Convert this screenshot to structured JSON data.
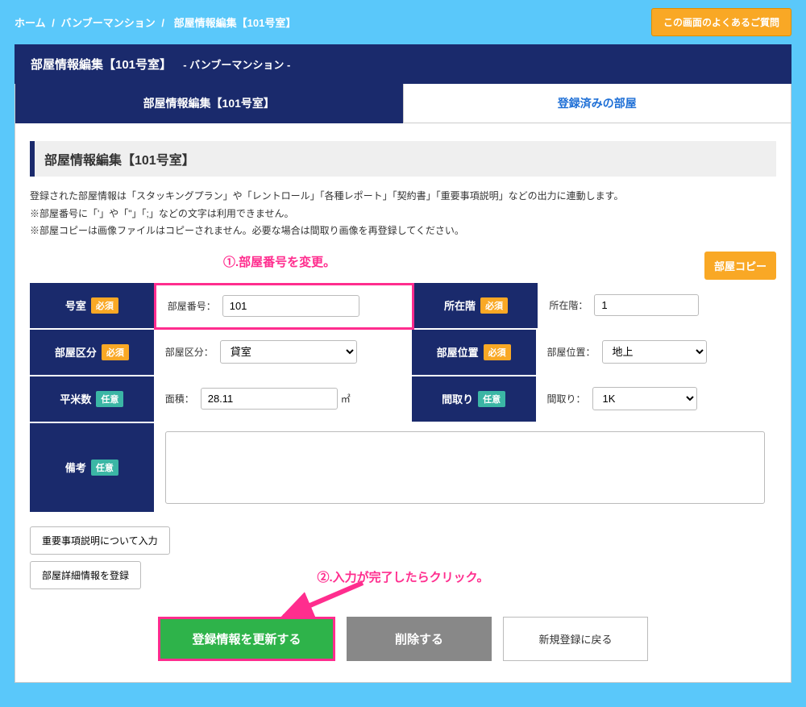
{
  "breadcrumb": {
    "home": "ホーム",
    "building": "バンブーマンション",
    "page": "部屋情報編集【101号室】"
  },
  "faq_button": "この画面のよくあるご質問",
  "title": {
    "main": "部屋情報編集【101号室】",
    "sub": "- バンブーマンション -"
  },
  "tabs": {
    "edit": "部屋情報編集【101号室】",
    "registered": "登録済みの部屋"
  },
  "section_heading": "部屋情報編集【101号室】",
  "notes": {
    "line1": "登録された部屋情報は「スタッキングプラン」や「レントロール」「各種レポート」「契約書」「重要事項説明」などの出力に連動します。",
    "line2": "※部屋番号に「'」や「\"」「;」などの文字は利用できません。",
    "line3": "※部屋コピーは画像ファイルはコピーされません。必要な場合は間取り画像を再登録してください。"
  },
  "copy_button": "部屋コピー",
  "annotations": {
    "a1": "①.部屋番号を変更。",
    "a2": "②.入力が完了したらクリック。"
  },
  "fields": {
    "room_no": {
      "label": "号室",
      "badge": "必須",
      "field_label": "部屋番号：",
      "value": "101"
    },
    "floor": {
      "label": "所在階",
      "badge": "必須",
      "field_label": "所在階：",
      "value": "1"
    },
    "room_type": {
      "label": "部屋区分",
      "badge": "必須",
      "field_label": "部屋区分：",
      "value": "貸室"
    },
    "room_pos": {
      "label": "部屋位置",
      "badge": "必須",
      "field_label": "部屋位置：",
      "value": "地上"
    },
    "area": {
      "label": "平米数",
      "badge": "任意",
      "field_label": "面積：",
      "value": "28.11",
      "unit": "㎡"
    },
    "layout": {
      "label": "間取り",
      "badge": "任意",
      "field_label": "間取り：",
      "value": "1K"
    },
    "remarks": {
      "label": "備考",
      "badge": "任意",
      "value": ""
    }
  },
  "sub_buttons": {
    "important": "重要事項説明について入力",
    "detail": "部屋詳細情報を登録"
  },
  "actions": {
    "update": "登録情報を更新する",
    "delete": "削除する",
    "back": "新規登録に戻る"
  }
}
